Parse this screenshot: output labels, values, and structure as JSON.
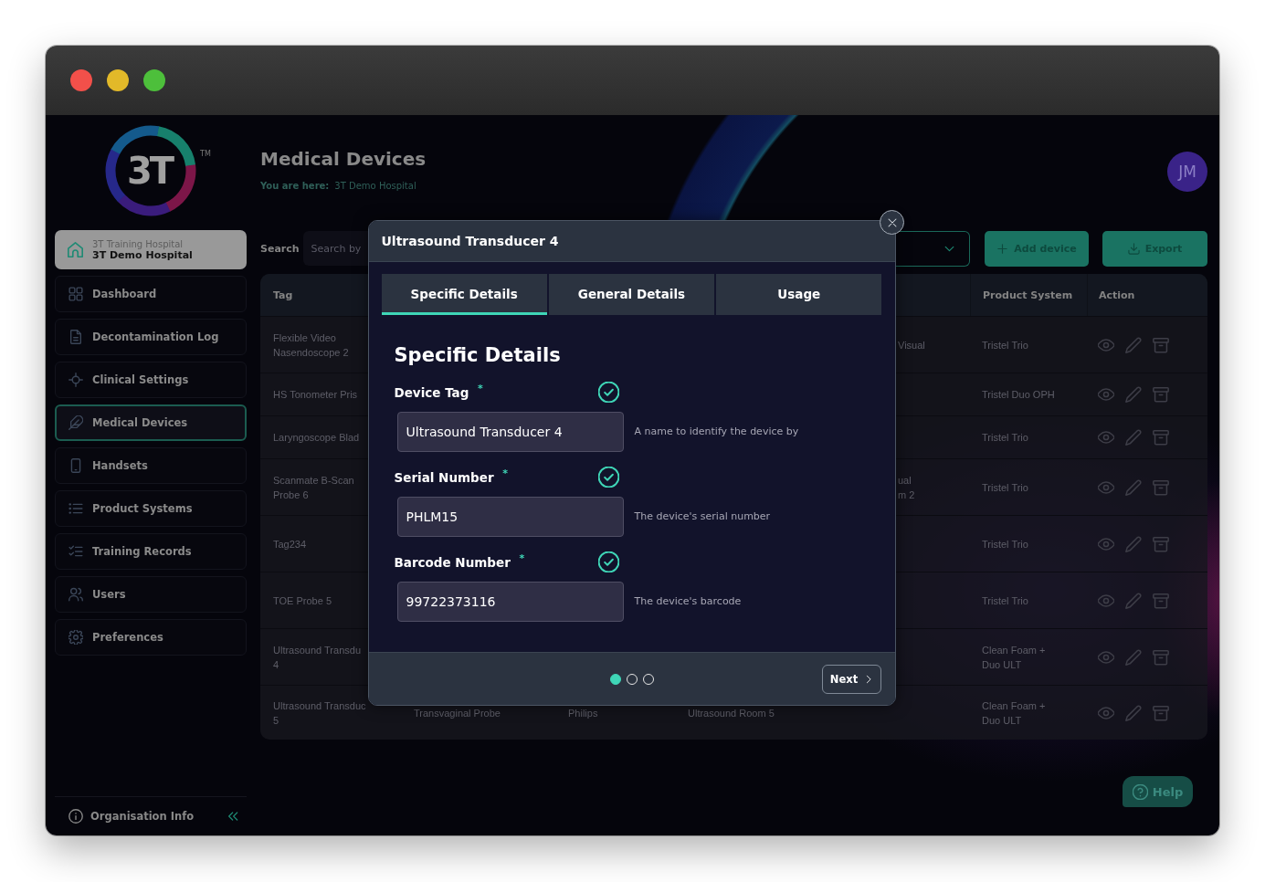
{
  "sidebar": {
    "logo": {
      "text": "3T",
      "mark": "TM"
    },
    "hospital": {
      "group": "3T Training Hospital",
      "name": "3T Demo Hospital"
    },
    "items": [
      {
        "label": "Dashboard",
        "selected": false
      },
      {
        "label": "Decontamination Log",
        "selected": false
      },
      {
        "label": "Clinical Settings",
        "selected": false
      },
      {
        "label": "Medical Devices",
        "selected": true
      },
      {
        "label": "Handsets",
        "selected": false
      },
      {
        "label": "Product Systems",
        "selected": false
      },
      {
        "label": "Training Records",
        "selected": false
      },
      {
        "label": "Users",
        "selected": false
      },
      {
        "label": "Preferences",
        "selected": false
      }
    ],
    "footer": {
      "label": "Organisation Info"
    }
  },
  "header": {
    "title": "Medical Devices",
    "breadcrumb_label": "You are here:",
    "breadcrumb": "3T Demo Hospital",
    "avatar": "JM"
  },
  "toolbar": {
    "search": {
      "label": "Search",
      "placeholder": "Search by"
    },
    "buttons": [
      {
        "kind": "add",
        "label": "Add device"
      },
      {
        "kind": "export",
        "label": "Export"
      }
    ]
  },
  "table": {
    "columns": {
      "tag": "Tag",
      "product_system": "Product System",
      "action": "Action"
    },
    "rows": [
      {
        "tag": "Flexible Video\nNasendoscope 2",
        "column_5": "Visual",
        "product_system": "Tristel Trio"
      },
      {
        "tag": "HS Tonometer Pris",
        "product_system": "Tristel Duo OPH"
      },
      {
        "tag": "Laryngoscope Blad",
        "product_system": "Tristel Trio"
      },
      {
        "tag": "Scanmate B-Scan\nProbe 6",
        "column_5": "ual\nm 2",
        "product_system": "Tristel Trio"
      },
      {
        "tag": "Tag234",
        "product_system": "Tristel Trio"
      },
      {
        "tag": "TOE Probe 5",
        "product_system": "Tristel Trio"
      },
      {
        "tag": "Ultrasound Transdu\n4",
        "product_system": "Clean Foam +\nDuo ULT"
      },
      {
        "tag": "Ultrasound Transduc\n5",
        "column_2": "Transvaginal Probe",
        "column_3": "Philips",
        "column_4": "Ultrasound Room 5",
        "product_system": "Clean Foam +\nDuo ULT"
      }
    ]
  },
  "modal": {
    "title": "Ultrasound Transducer 4",
    "tabs": [
      {
        "label": "Specific Details",
        "selected": true
      },
      {
        "label": "General Details",
        "selected": false
      },
      {
        "label": "Usage",
        "selected": false
      }
    ],
    "heading": "Specific Details",
    "fields": [
      {
        "label": "Device Tag $^{*}$",
        "valid": true,
        "value": "Ultrasound Transducer 4",
        "hint": "A name to identify the device by"
      },
      {
        "label": "Serial Number $^{*}$",
        "valid": true,
        "value": "PHLM15",
        "hint": "The device's serial number"
      },
      {
        "label": "Barcode Number $^{*}$",
        "valid": true,
        "value": "99722373116",
        "hint": "The device's barcode"
      }
    ],
    "steps": [
      {
        "selected": true
      },
      {
        "selected": false
      },
      {
        "selected": false
      }
    ],
    "next_button": "Next"
  },
  "help_button": {
    "label": "Help"
  }
}
